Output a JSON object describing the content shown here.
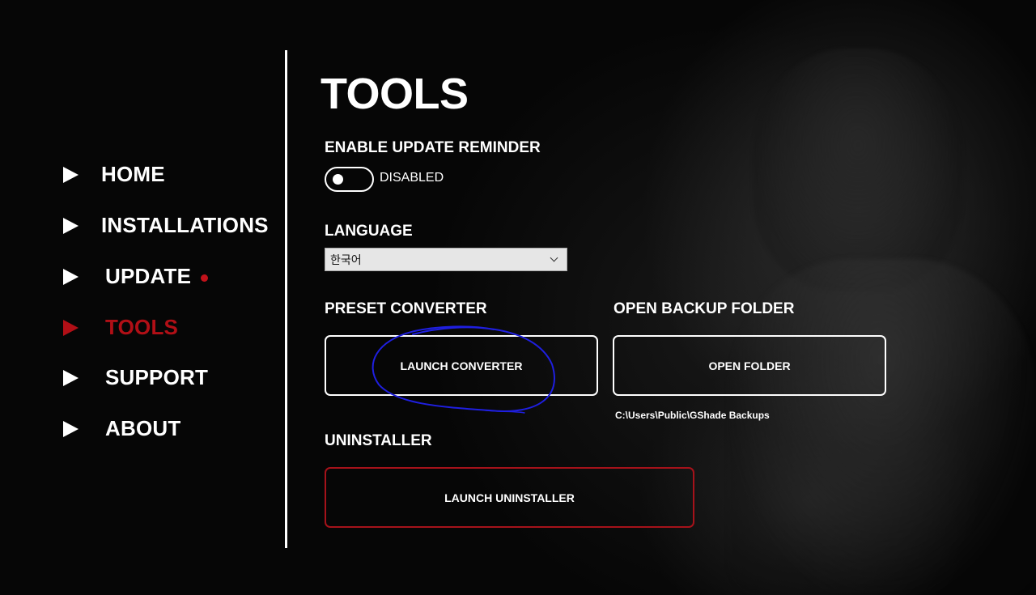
{
  "nav": {
    "items": [
      {
        "label": "HOME",
        "active": false
      },
      {
        "label": "INSTALLATIONS",
        "active": false
      },
      {
        "label": "UPDATE",
        "active": false,
        "badge": true
      },
      {
        "label": "TOOLS",
        "active": true
      },
      {
        "label": "SUPPORT",
        "active": false
      },
      {
        "label": "ABOUT",
        "active": false
      }
    ]
  },
  "page": {
    "title": "TOOLS"
  },
  "update_reminder": {
    "label": "ENABLE UPDATE REMINDER",
    "state_text": "DISABLED",
    "enabled": false
  },
  "language": {
    "label": "LANGUAGE",
    "selected": "한국어"
  },
  "preset_converter": {
    "label": "PRESET CONVERTER",
    "button": "LAUNCH CONVERTER"
  },
  "backup": {
    "label": "OPEN BACKUP FOLDER",
    "button": "OPEN FOLDER",
    "path": "C:\\Users\\Public\\GShade Backups"
  },
  "uninstaller": {
    "label": "UNINSTALLER",
    "button": "LAUNCH UNINSTALLER"
  },
  "colors": {
    "accent_red": "#b10f16",
    "annotation_blue": "#1f1fe0"
  }
}
